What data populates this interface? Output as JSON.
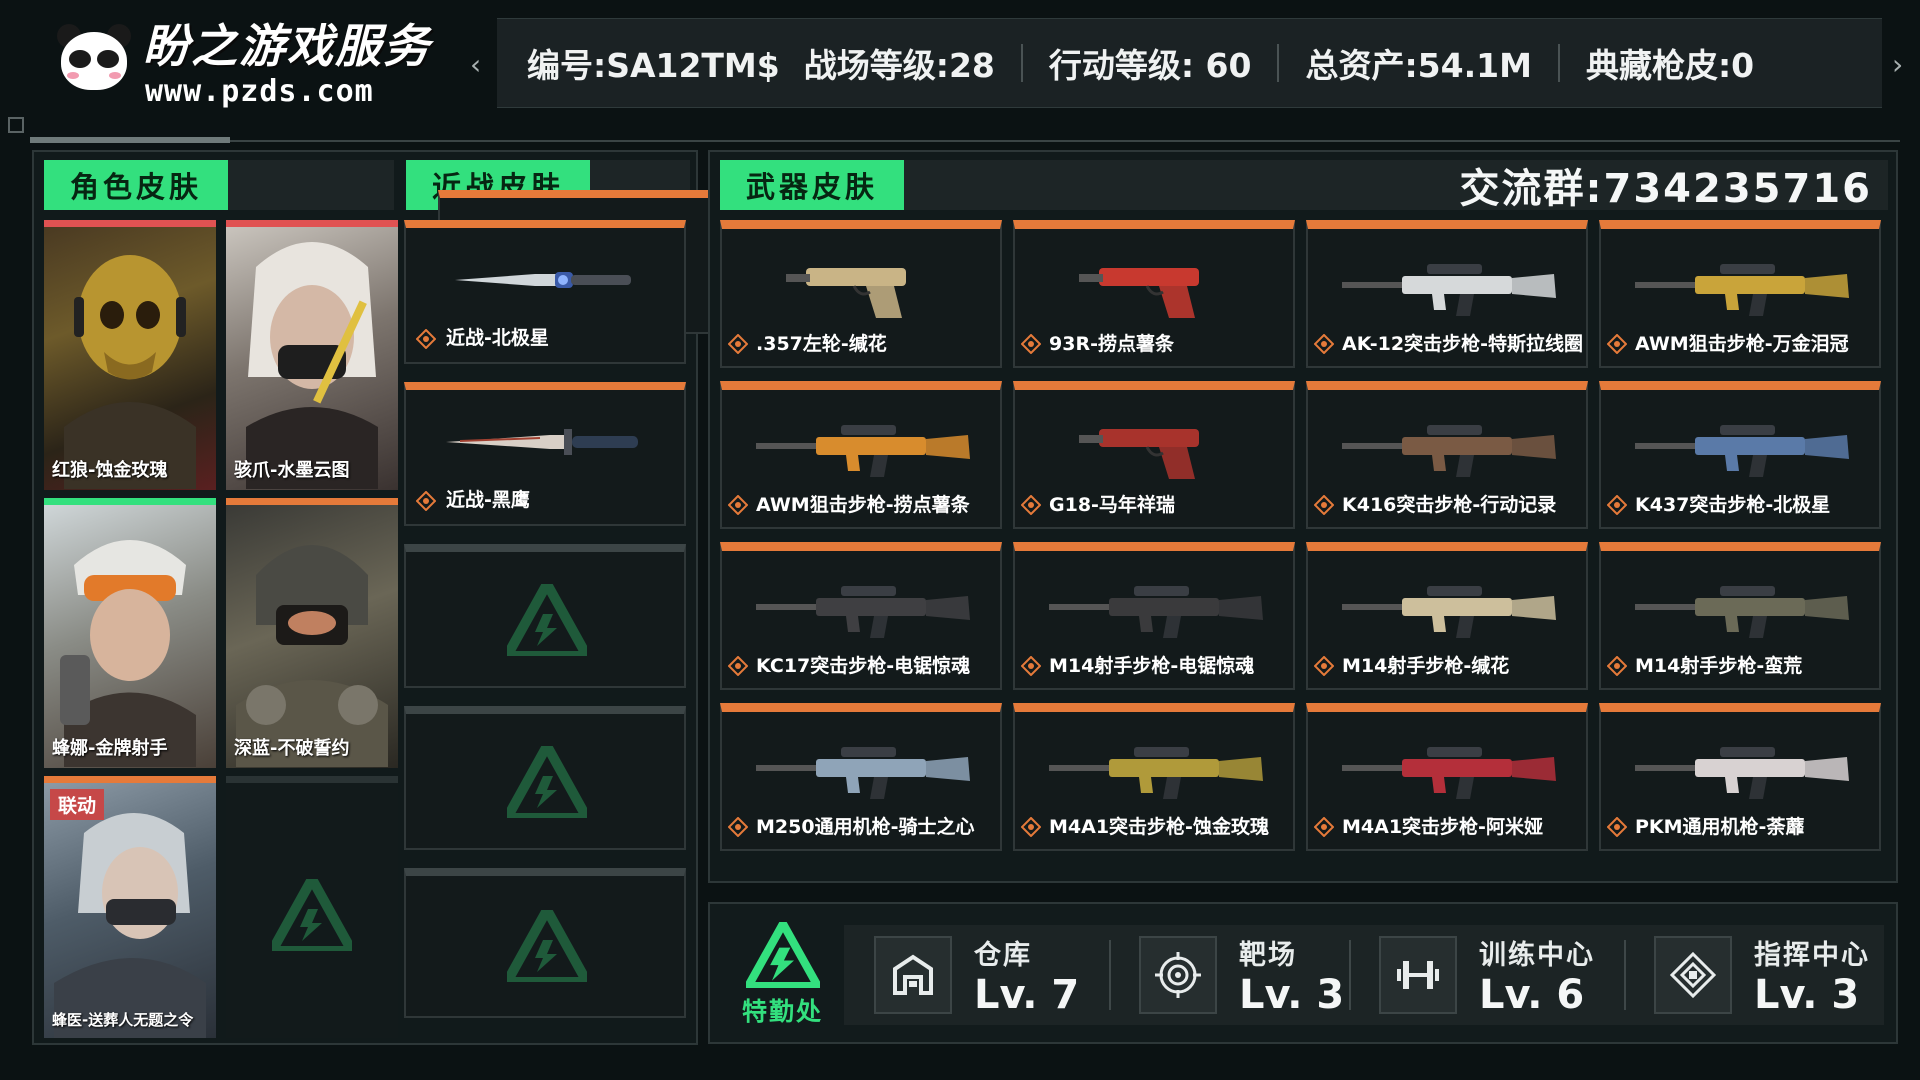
{
  "logo": {
    "brand": "盼之游戏服务",
    "url": "www.pzds.com"
  },
  "header": {
    "account_id": "编号:SA12TM$",
    "battlefield_level": "战场等级:28",
    "operation_level": "行动等级: 60",
    "total_assets": "总资产:54.1M",
    "collection_skins": "典藏枪皮:0"
  },
  "tabs": {
    "character": "角色皮肤",
    "melee": "近战皮肤",
    "weapon": "武器皮肤"
  },
  "group": "交流群:734235716",
  "characters": [
    {
      "name": "红狼-蚀金玫瑰",
      "color": "#e05252"
    },
    {
      "name": "骇爪-水墨云图",
      "color": "#e05252"
    },
    {
      "name": "蜂娜-金牌射手",
      "color": "#33e07e"
    },
    {
      "name": "深蓝-不破誓约",
      "color": "#e57a3a"
    },
    {
      "name": "蜂医-送葬人无题之令",
      "tag": "联动",
      "color": "#e57a3a"
    }
  ],
  "melee": [
    {
      "name": "近战-北极星"
    },
    {
      "name": "近战-黑鹰"
    }
  ],
  "weapons": [
    {
      "name": ".357左轮-缄花",
      "tint": "#c9b486"
    },
    {
      "name": "93R-捞点薯条",
      "tint": "#c8392f"
    },
    {
      "name": "AK-12突击步枪-特斯拉线圈",
      "tint": "#d6d9da"
    },
    {
      "name": "AWM狙击步枪-万金泪冠",
      "tint": "#c9a43a"
    },
    {
      "name": "AWM狙击步枪-捞点薯条",
      "tint": "#d88c2d"
    },
    {
      "name": "G18-马年祥瑞",
      "tint": "#a8332c"
    },
    {
      "name": "K416突击步枪-行动记录",
      "tint": "#7a5a44"
    },
    {
      "name": "K437突击步枪-北极星",
      "tint": "#5a7aa8"
    },
    {
      "name": "KC17突击步枪-电锯惊魂",
      "tint": "#3f3f42"
    },
    {
      "name": "M14射手步枪-电锯惊魂",
      "tint": "#3a3a3c"
    },
    {
      "name": "M14射手步枪-缄花",
      "tint": "#cdbf9c"
    },
    {
      "name": "M14射手步枪-蛮荒",
      "tint": "#6b6a57"
    },
    {
      "name": "M250通用机枪-骑士之心",
      "tint": "#8fa4b8"
    },
    {
      "name": "M4A1突击步枪-蚀金玫瑰",
      "tint": "#b09a3a"
    },
    {
      "name": "M4A1突击步枪-阿米娅",
      "tint": "#b42f3a"
    },
    {
      "name": "PKM通用机枪-荼蘼",
      "tint": "#d8d2d2"
    }
  ],
  "department": "特勤处",
  "facilities": [
    {
      "name": "仓库",
      "level": "Lv. 7",
      "icon": "warehouse-icon"
    },
    {
      "name": "靶场",
      "level": "Lv. 3",
      "icon": "target-icon"
    },
    {
      "name": "训练中心",
      "level": "Lv. 6",
      "icon": "dumbbell-icon"
    },
    {
      "name": "指挥中心",
      "level": "Lv. 3",
      "icon": "command-icon"
    }
  ]
}
